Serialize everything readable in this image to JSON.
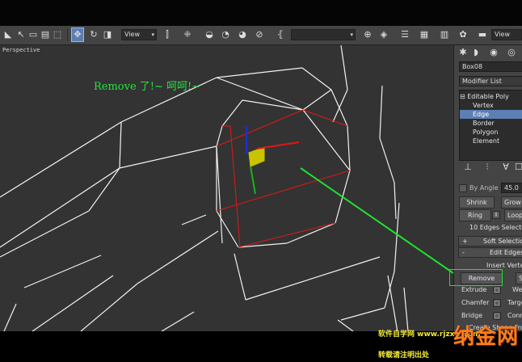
{
  "toolbar": {
    "reference_dropdown": "View",
    "view_dropdown": "View",
    "selection_set": "",
    "icons": [
      "select-icon",
      "select-region-icon",
      "select-by-name-icon",
      "window-crossing-icon",
      "move-icon",
      "rotate-icon",
      "scale-icon",
      "snap-icon",
      "angle-snap-icon",
      "percent-snap-icon",
      "spinner-snap-icon",
      "edit-named-sets-icon",
      "mirror-icon",
      "align-icon",
      "layer-icon",
      "curve-editor-icon",
      "schematic-icon",
      "material-editor-icon",
      "render-setup-icon",
      "render-icon"
    ]
  },
  "viewport": {
    "label": "Perspective",
    "annotation": "Remove 了!~ 呵呵!~",
    "colors": {
      "wire": "#f2f2f2",
      "selected_edge": "#e11818",
      "arrow": "#1fe22e",
      "gizmo_x": "#e3151b",
      "gizmo_y": "#1ab51a",
      "gizmo_z": "#1b2fd9",
      "gizmo_plane": "#c9c300"
    }
  },
  "panel": {
    "object_name": "Box08",
    "modifier_list": "Modifier List",
    "stack": [
      {
        "label": "Editable Poly",
        "level": 0
      },
      {
        "label": "Vertex",
        "level": 1
      },
      {
        "label": "Edge",
        "level": 1
      },
      {
        "label": "Border",
        "level": 1
      },
      {
        "label": "Polygon",
        "level": 1
      },
      {
        "label": "Element",
        "level": 1
      }
    ],
    "selected_stack_index": 2,
    "by_angle": "By Angle",
    "by_angle_value": "45.0",
    "shrink": "Shrink",
    "grow": "Grow",
    "ring": "Ring",
    "loop": "Loop",
    "edges_selected": "10 Edges Selected",
    "soft_selection": "Soft Selection",
    "edit_edges": "Edit Edges",
    "insert_vertex": "Insert Vertex",
    "remove": "Remove",
    "split": "Split",
    "extrude": "Extrude",
    "weld": "Weld",
    "chamfer": "Chamfer",
    "target_weld": "Target Weld",
    "bridge": "Bridge",
    "connect": "Connect",
    "create_shape": "Create Shape From Selection",
    "rollout_plus": "+",
    "rollout_minus": "-",
    "settings_glyph": "□",
    "accent": "#5c7fb4"
  },
  "watermark": {
    "logo": "纳金网",
    "line1": "软件自学网 www.rjzxw.com",
    "line2": "转载请注明出处"
  }
}
